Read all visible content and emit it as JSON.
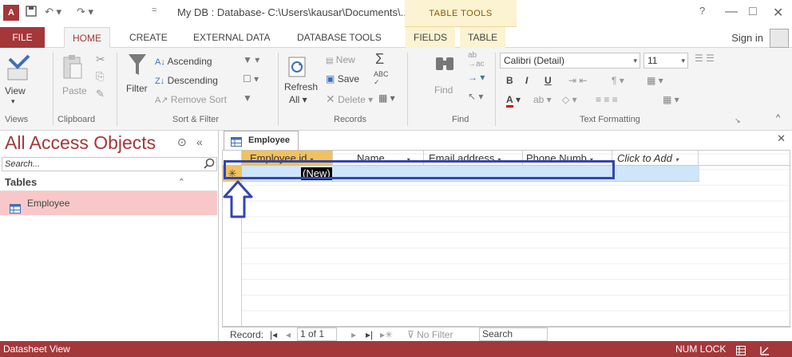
{
  "window": {
    "app_logo": "A",
    "title": "My DB : Database- C:\\Users\\kausar\\Documents\\...",
    "context_tools": "TABLE TOOLS",
    "help": "?",
    "minimize": "—",
    "maximize": "□",
    "close": "✕"
  },
  "tabs": {
    "file": "FILE",
    "home": "HOME",
    "create": "CREATE",
    "external_data": "EXTERNAL DATA",
    "database_tools": "DATABASE TOOLS",
    "fields": "FIELDS",
    "table": "TABLE",
    "sign_in": "Sign in"
  },
  "ribbon": {
    "views": {
      "view": "View",
      "label": "Views"
    },
    "clipboard": {
      "paste": "Paste",
      "label": "Clipboard"
    },
    "sort_filter": {
      "filter": "Filter",
      "ascending": "Ascending",
      "descending": "Descending",
      "remove_sort": "Remove Sort",
      "label": "Sort & Filter"
    },
    "records": {
      "refresh": "Refresh",
      "all": "All",
      "new": "New",
      "save": "Save",
      "delete": "Delete",
      "label": "Records"
    },
    "find": {
      "find": "Find",
      "label": "Find"
    },
    "text_formatting": {
      "font": "Calibri (Detail)",
      "size": "11",
      "bold": "B",
      "italic": "I",
      "underline": "U",
      "label": "Text Formatting"
    }
  },
  "nav": {
    "title": "All Access Objects",
    "search_placeholder": "Search...",
    "group": "Tables",
    "items": [
      {
        "label": "Employee"
      }
    ]
  },
  "document": {
    "tab_label": "Employee",
    "columns": [
      "Employee id",
      "Name",
      "Email address",
      "Phone Numb",
      "Click to Add"
    ],
    "new_row_marker": "✳",
    "new_row_value": "(New)",
    "record_nav": {
      "label": "Record:",
      "position": "1 of 1",
      "no_filter": "No Filter",
      "search": "Search"
    }
  },
  "status": {
    "left": "Datasheet View",
    "right": "NUM LOCK"
  },
  "colors": {
    "accent": "#a4373a",
    "highlight_box": "#3345b0",
    "active_header": "#f1c15d",
    "new_row": "#cfe5f9"
  }
}
